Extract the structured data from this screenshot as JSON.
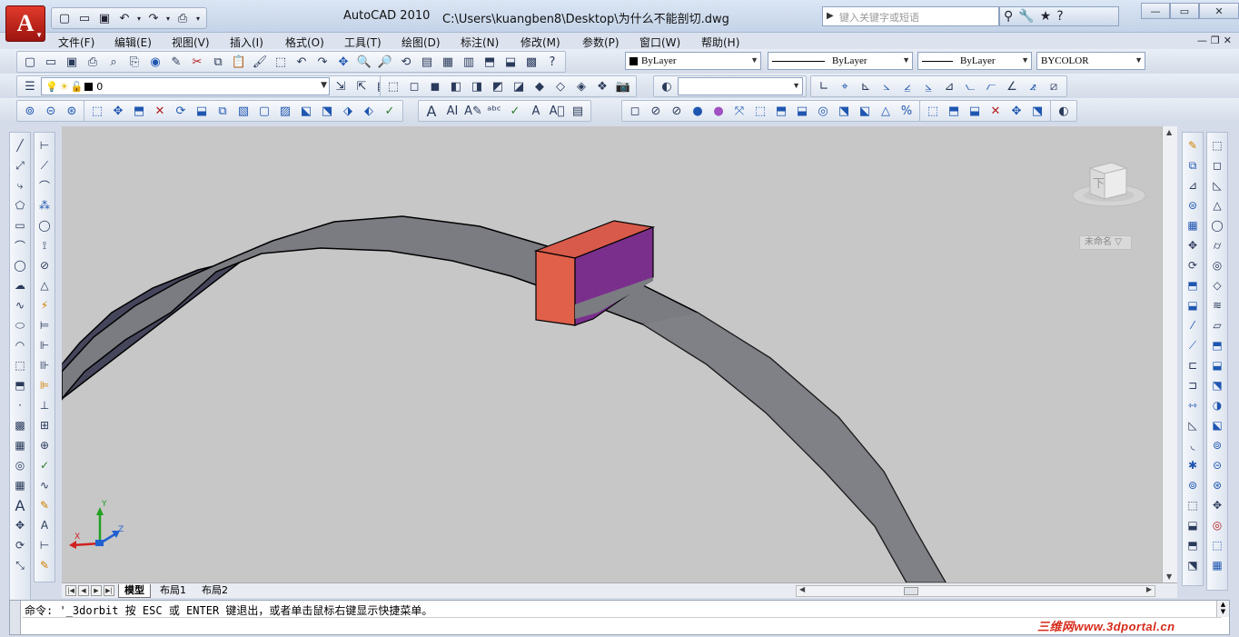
{
  "window": {
    "app_name": "AutoCAD 2010",
    "file_path": "C:\\Users\\kuangben8\\Desktop\\为什么不能剖切.dwg",
    "search_placeholder": "键入关键字或短语"
  },
  "menu": [
    "文件(F)",
    "编辑(E)",
    "视图(V)",
    "插入(I)",
    "格式(O)",
    "工具(T)",
    "绘图(D)",
    "标注(N)",
    "修改(M)",
    "参数(P)",
    "窗口(W)",
    "帮助(H)"
  ],
  "properties": {
    "color": "ByLayer",
    "linetype": "ByLayer",
    "lineweight": "ByLayer",
    "plotstyle": "BYCOLOR"
  },
  "layer": {
    "current": "0"
  },
  "viewcube": {
    "face_label": "下",
    "named_view": "未命名"
  },
  "ucs": {
    "x": "X",
    "y": "Y",
    "z": "Z"
  },
  "layout_tabs": {
    "model": "模型",
    "layout1": "布局1",
    "layout2": "布局2"
  },
  "command_line": {
    "text": "命令: '_3dorbit 按 ESC 或 ENTER 键退出，或者单击鼠标右键显示快捷菜单。"
  },
  "watermark": "三维网www.3dportal.cn",
  "colors": {
    "canvas_bg": "#c7c7c7",
    "ring_top": "#7a7a80",
    "ring_side": "#45455c",
    "box_front": "#e0604a",
    "box_side": "#7a2f8c",
    "box_top": "#d85a4a"
  }
}
